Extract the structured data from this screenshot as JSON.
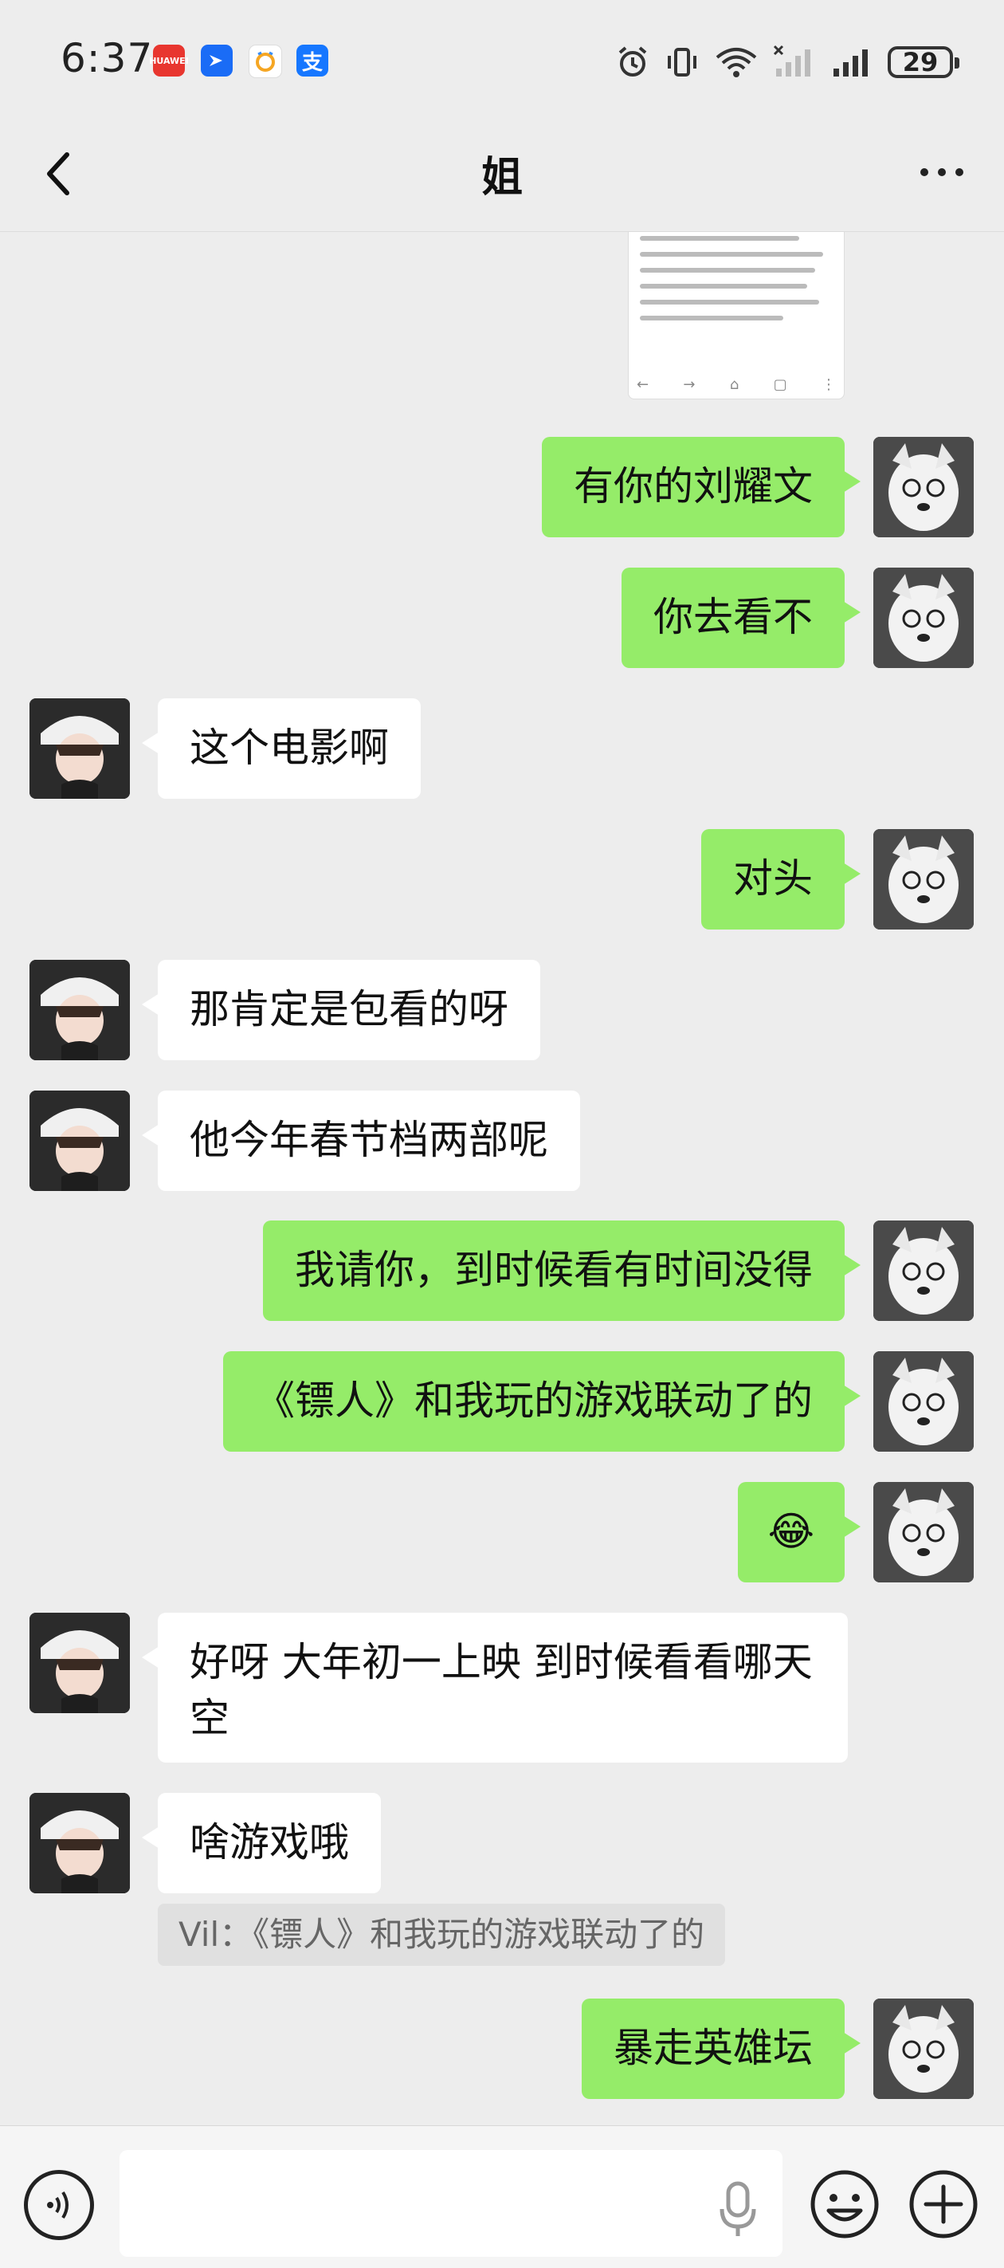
{
  "status_bar": {
    "time": "6:37",
    "battery": "29",
    "app_icons": [
      "huawei-appgallery-icon",
      "feishu-icon",
      "alarm-app-icon",
      "alipay-icon"
    ]
  },
  "header": {
    "title": "姐"
  },
  "messages": [
    {
      "side": "out",
      "text": "有你的刘耀文"
    },
    {
      "side": "out",
      "text": "你去看不"
    },
    {
      "side": "in",
      "text": "这个电影啊"
    },
    {
      "side": "out",
      "text": "对头"
    },
    {
      "side": "in",
      "text": "那肯定是包看的呀"
    },
    {
      "side": "in",
      "text": "他今年春节档两部呢"
    },
    {
      "side": "out",
      "text": "我请你，到时候看有时间没得"
    },
    {
      "side": "out",
      "text": "《镖人》和我玩的游戏联动了的"
    },
    {
      "side": "out",
      "text": "😂"
    },
    {
      "side": "in",
      "text": "好呀 大年初一上映 到时候看看哪天空"
    },
    {
      "side": "in",
      "text": "啥游戏哦"
    },
    {
      "side": "out",
      "text": "暴走英雄坛"
    }
  ],
  "quote": {
    "text": "Vil：《镖人》和我玩的游戏联动了的"
  },
  "input": {
    "value": ""
  },
  "colors": {
    "outgoing_bubble": "#95ec69",
    "incoming_bubble": "#ffffff",
    "background": "#ededed"
  }
}
